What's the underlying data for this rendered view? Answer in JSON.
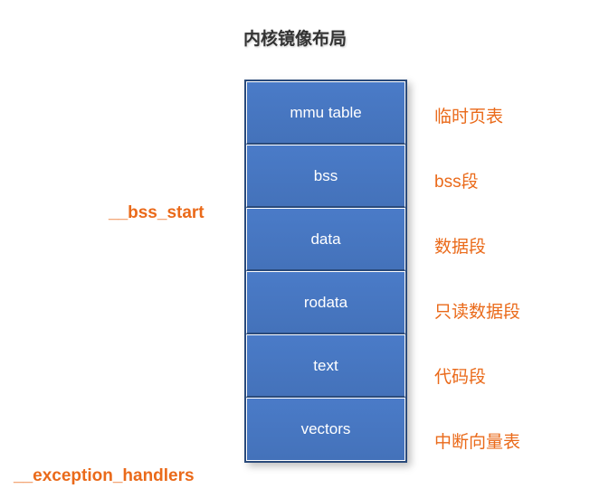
{
  "title": "内核镜像布局",
  "segments": [
    {
      "name": "mmu table",
      "description": "临时页表"
    },
    {
      "name": "bss",
      "description": "bss段"
    },
    {
      "name": "data",
      "description": "数据段"
    },
    {
      "name": "rodata",
      "description": "只读数据段"
    },
    {
      "name": "text",
      "description": "代码段"
    },
    {
      "name": "vectors",
      "description": "中断向量表"
    }
  ],
  "left_labels": [
    {
      "text": "__bss_start"
    },
    {
      "text": "__exception_handlers"
    }
  ]
}
